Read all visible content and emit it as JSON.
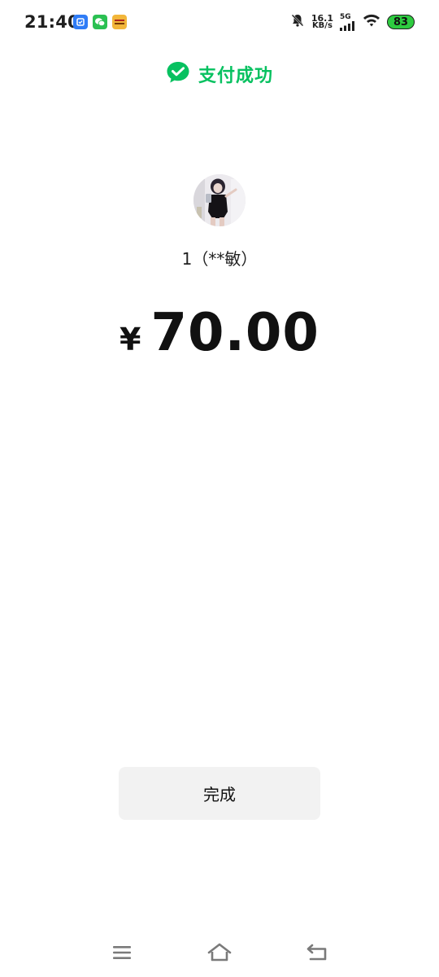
{
  "status_bar": {
    "time": "21:40",
    "net_speed_value": "16.1",
    "net_speed_unit": "KB/s",
    "network_type": "5G",
    "battery_level": "83",
    "battery_color": "#2ecc40",
    "app_icons": [
      "tasks-app-icon",
      "wechat-icon",
      "news-app-icon"
    ]
  },
  "header": {
    "title": "支付成功",
    "accent_color": "#07c160"
  },
  "payee": {
    "name": "1（**敏）"
  },
  "payment": {
    "currency_symbol": "¥",
    "amount": "70.00"
  },
  "actions": {
    "done_label": "完成"
  },
  "nav": {
    "items": [
      "menu-icon",
      "home-icon",
      "back-icon"
    ]
  }
}
